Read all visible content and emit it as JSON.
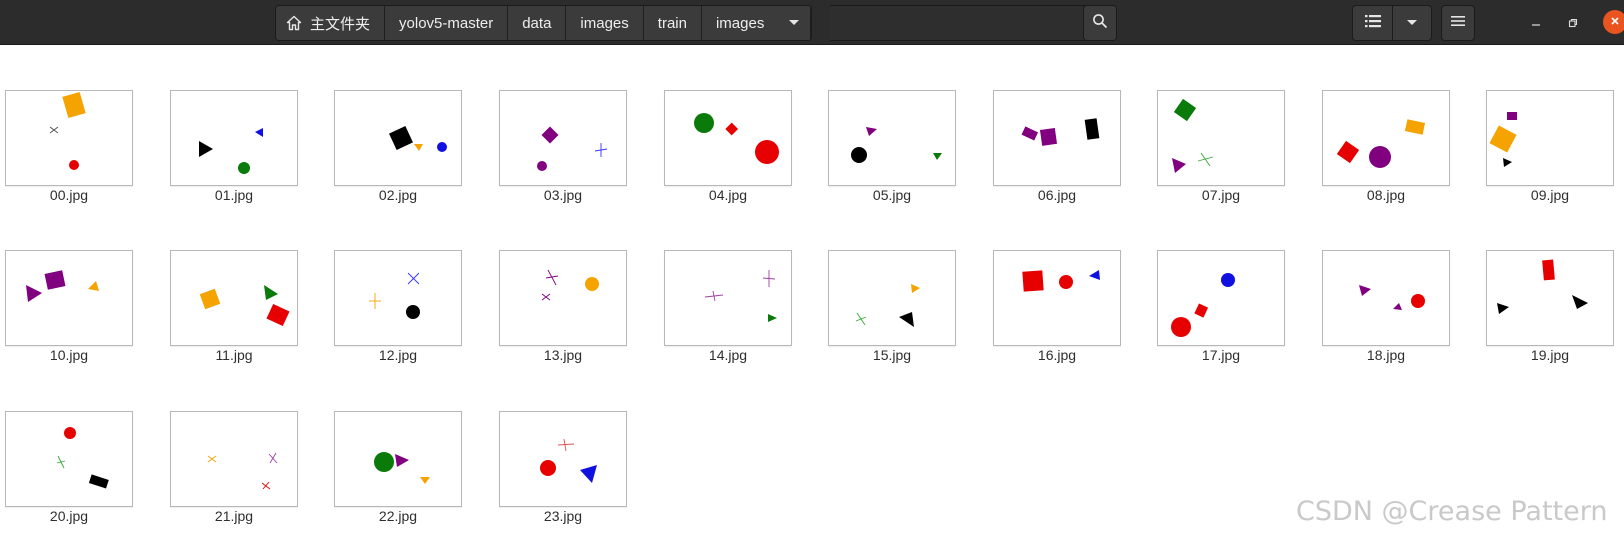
{
  "path_bar": {
    "home_label": "主文件夹",
    "segments": [
      "yolov5-master",
      "data",
      "images",
      "train",
      "images"
    ]
  },
  "toolbar": {
    "search_icon": "search-icon",
    "view_list_icon": "list-view-icon",
    "view_options_icon": "chevron-down-icon",
    "menu_icon": "hamburger-menu-icon"
  },
  "window_controls": [
    "minimize-icon",
    "restore-icon",
    "close-icon"
  ],
  "files": [
    {
      "name": "00.jpg"
    },
    {
      "name": "01.jpg"
    },
    {
      "name": "02.jpg"
    },
    {
      "name": "03.jpg"
    },
    {
      "name": "04.jpg"
    },
    {
      "name": "05.jpg"
    },
    {
      "name": "06.jpg"
    },
    {
      "name": "07.jpg"
    },
    {
      "name": "08.jpg"
    },
    {
      "name": "09.jpg"
    },
    {
      "name": "10.jpg"
    },
    {
      "name": "11.jpg"
    },
    {
      "name": "12.jpg"
    },
    {
      "name": "13.jpg"
    },
    {
      "name": "14.jpg"
    },
    {
      "name": "15.jpg"
    },
    {
      "name": "16.jpg"
    },
    {
      "name": "17.jpg"
    },
    {
      "name": "18.jpg"
    },
    {
      "name": "19.jpg"
    },
    {
      "name": "20.jpg"
    },
    {
      "name": "21.jpg"
    },
    {
      "name": "22.jpg"
    },
    {
      "name": "23.jpg"
    }
  ],
  "watermark": "CSDN @Crease Pattern"
}
